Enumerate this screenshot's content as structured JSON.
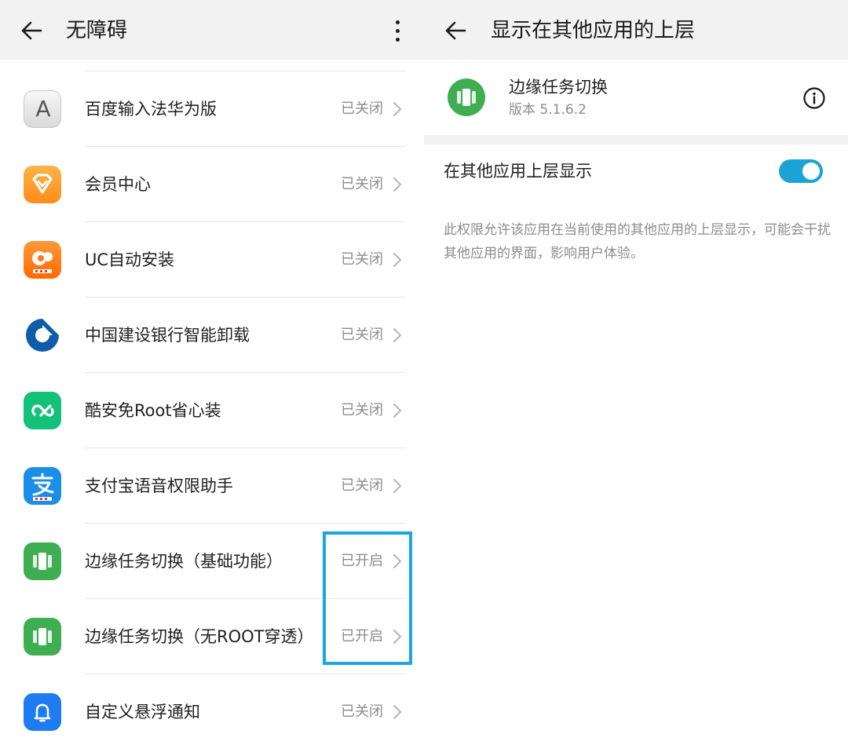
{
  "left": {
    "title": "无障碍",
    "apps": [
      {
        "name": "百度输入法华为版",
        "status": "已关闭",
        "icon": "baidu-input-icon"
      },
      {
        "name": "会员中心",
        "status": "已关闭",
        "icon": "member-center-icon"
      },
      {
        "name": "UC自动安装",
        "status": "已关闭",
        "icon": "uc-browser-icon"
      },
      {
        "name": "中国建设银行智能卸载",
        "status": "已关闭",
        "icon": "ccb-bank-icon"
      },
      {
        "name": "酷安免Root省心装",
        "status": "已关闭",
        "icon": "coolapk-icon"
      },
      {
        "name": "支付宝语音权限助手",
        "status": "已关闭",
        "icon": "alipay-icon"
      },
      {
        "name": "边缘任务切换（基础功能）",
        "status": "已开启",
        "icon": "edge-task-switch-icon"
      },
      {
        "name": "边缘任务切换（无ROOT穿透）",
        "status": "已开启",
        "icon": "edge-task-switch-icon"
      },
      {
        "name": "自定义悬浮通知",
        "status": "已关闭",
        "icon": "floating-notification-icon"
      }
    ],
    "icon_letter": "A"
  },
  "right": {
    "title": "显示在其他应用的上层",
    "app": {
      "name": "边缘任务切换",
      "version": "版本 5.1.6.2"
    },
    "setting": {
      "label": "在其他应用上层显示",
      "enabled": true
    },
    "description": "此权限允许该应用在当前使用的其他应用的上层显示，可能会干扰其他应用的界面，影响用户体验。"
  },
  "colors": {
    "accent": "#1aa3d4",
    "highlight_border": "#1aa7e0",
    "toolbar_bg": "#f2f2f2",
    "status_text": "#8c8c8c"
  }
}
